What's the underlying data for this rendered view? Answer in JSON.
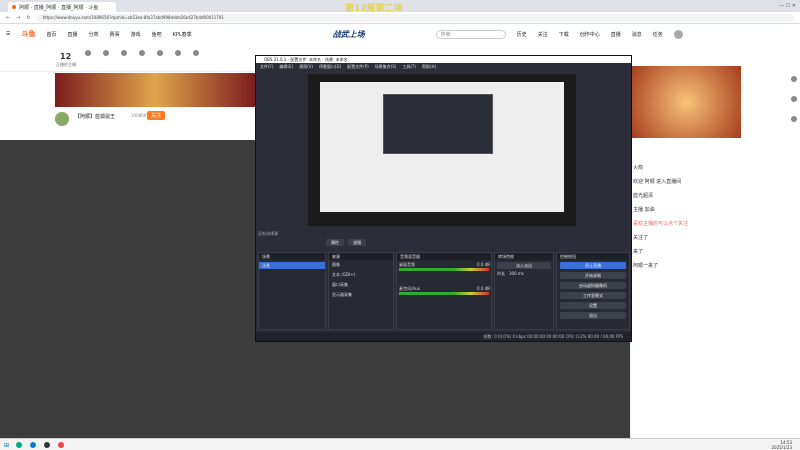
{
  "browser": {
    "tab_title": "阿顺 · 直播_阿顺 · 直播_阿顺 · 斗鱼",
    "url": "https://www.douyu.com/1089656?dyshid=cb53ea-8fa37abd998dddd26e427b4d00011701"
  },
  "nav": {
    "items": [
      "首页",
      "直播",
      "分类",
      "赛事",
      "游戏",
      "鱼吧",
      "KPL春季"
    ],
    "header_text": "战武上场",
    "header_title_overlay": "第12周第二场",
    "search_placeholder": "搜索",
    "user_items": [
      "历史",
      "关注",
      "下载",
      "创作中心",
      "直播",
      "消息",
      "任务"
    ]
  },
  "subnav": {
    "count": "12",
    "count_label": "正播的主播",
    "icons": [
      "直播开关",
      "开播",
      "鱼吧",
      "直播中心",
      "数据",
      "开播设置",
      "斗鱼学院"
    ]
  },
  "streamer": {
    "name": "【阿顺】蓝狐鼠王",
    "id": "10089656",
    "follow_label": "关注"
  },
  "obs": {
    "title": "OBS 31.0.1 - 配置文件: 未命名 - 场景: 未命名",
    "menu": [
      "文件(F)",
      "编辑(E)",
      "视图(V)",
      "停靠窗口(D)",
      "配置文件(P)",
      "场景集合(S)",
      "工具(T)",
      "帮助(H)"
    ],
    "no_source": "没有选择源",
    "props_btn": "属性",
    "filters_btn": "滤镜",
    "panels": {
      "scenes": {
        "title": "场景",
        "items": [
          "场景"
        ]
      },
      "sources": {
        "title": "来源",
        "items": [
          "图像",
          "文本 (GDI+)",
          "窗口采集",
          "显示器采集"
        ]
      },
      "mixer": {
        "title": "音频混音器",
        "tracks": [
          {
            "name": "桌面音频",
            "db": "0.0 dB"
          },
          {
            "name": "麦克风/Aux",
            "db": "0.0 dB"
          }
        ]
      },
      "transitions": {
        "title": "转场特效",
        "type": "淡入淡出",
        "duration_label": "时长",
        "duration": "300 ms"
      },
      "controls": {
        "title": "控制按钮",
        "buttons": [
          "停止直播",
          "开始录制",
          "启动虚拟摄像机",
          "工作室模式",
          "设置",
          "退出"
        ]
      }
    },
    "status": "帧数: 0 (0.0%) 0 kbps 00:00:00 00:00:00 CPU: 0.2% 60.00 / 60.00 FPS"
  },
  "chat": {
    "messages": [
      "火箭",
      "欢迎 阿顺 进入直播间",
      "蓝光超清",
      "主播 加油",
      "关注了",
      "来了",
      "阿顺一来了"
    ],
    "highlight": "喜欢主播的可以点个关注"
  },
  "taskbar": {
    "time": "14:53",
    "date": "2025/1/23"
  }
}
